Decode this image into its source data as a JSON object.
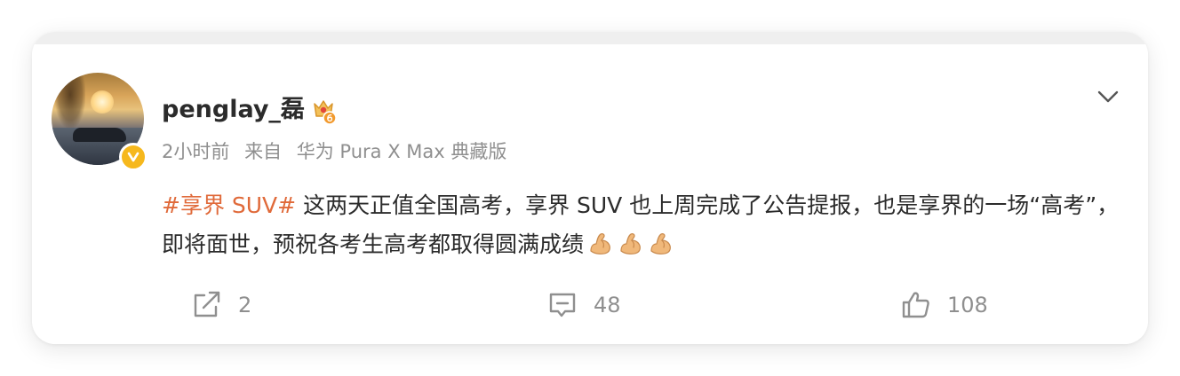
{
  "post": {
    "username": "penglay_磊",
    "level_badge_icon": "level-6-badge-icon",
    "verified_icon": "verified-v-icon",
    "meta": {
      "time": "2小时前",
      "source_prefix": "来自",
      "device": "华为 Pura X Max 典藏版"
    },
    "content": {
      "hashtag": "#享界 SUV#",
      "text": " 这两天正值全国高考，享界 SUV 也上周完成了公告提报，也是享界的一场“高考”，即将面世，预祝各考生高考都取得圆满成绩",
      "emoji_icon": "flexed-biceps-icon",
      "emoji_count": 3
    },
    "actions": {
      "repost_count": "2",
      "comment_count": "48",
      "like_count": "108"
    }
  },
  "colors": {
    "hashtag": "#e06a3a",
    "text": "#2b2b2b",
    "meta": "#8f8f8f",
    "verified": "#f6b81d"
  }
}
